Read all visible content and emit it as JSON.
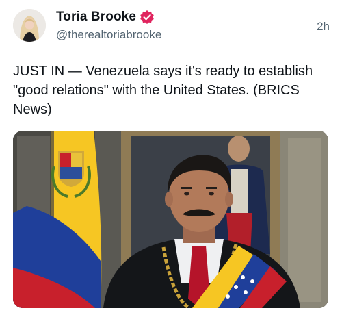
{
  "author": {
    "display_name": "Toria Brooke",
    "handle": "@therealtoriabrooke",
    "verified_icon": "verified-badge-icon",
    "avatar_icon": "avatar"
  },
  "post": {
    "timestamp": "2h",
    "text": "JUST IN — Venezuela says it's ready to establish \"good relations\" with the United States. (BRICS News)",
    "media_kind": "photo"
  },
  "colors": {
    "verified_badge": "#e0245e",
    "handle": "#536471",
    "text": "#0f1419",
    "flag_yellow": "#f6c623",
    "flag_blue": "#1f3f9a",
    "flag_red": "#c8202c"
  }
}
